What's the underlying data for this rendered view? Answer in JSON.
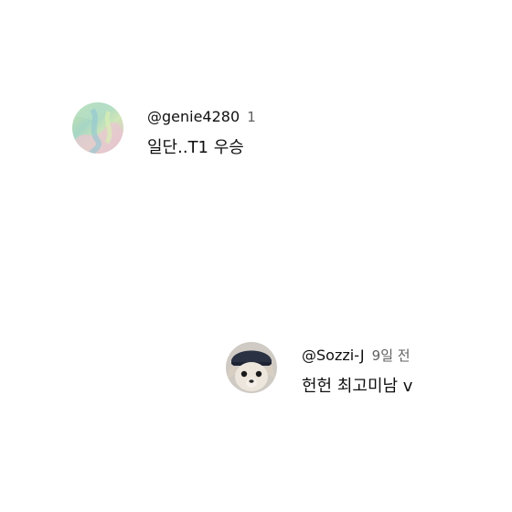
{
  "comments": [
    {
      "handle": "@genie4280",
      "time": "1",
      "text": "일단..T1 우승",
      "avatar_icon": "abstract-pastel-avatar"
    },
    {
      "handle": "@Sozzi-J",
      "time": "9일 전",
      "text": "헌헌 최고미남  v",
      "avatar_icon": "chihuahua-with-cap-avatar"
    }
  ]
}
